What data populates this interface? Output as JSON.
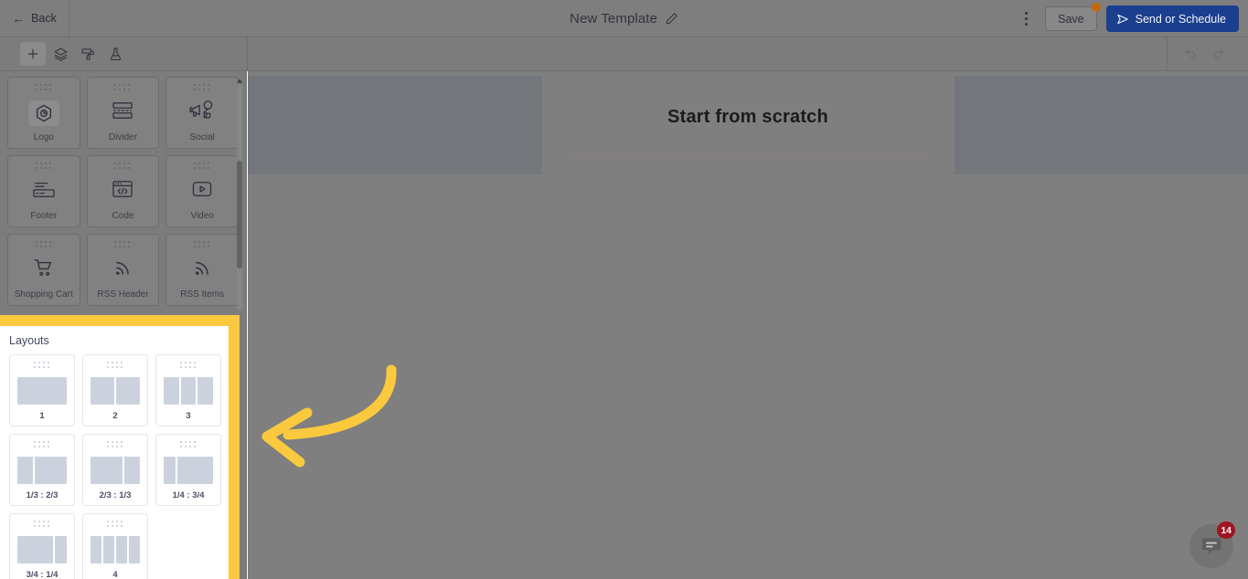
{
  "header": {
    "back_label": "Back",
    "back_icon": "arrow-left-icon",
    "title": "New Template",
    "edit_icon": "pencil-icon",
    "more_icon": "kebab-menu-icon",
    "save_label": "Save",
    "save_badge_color": "#c2680a",
    "send_label": "Send or Schedule",
    "send_icon": "paper-plane-icon",
    "send_color": "#1b3f8f"
  },
  "toolbar": {
    "tools": [
      {
        "name": "add-block-icon",
        "label": "Add",
        "active": true
      },
      {
        "name": "layers-icon",
        "label": "Layers",
        "active": false
      },
      {
        "name": "paint-roller-icon",
        "label": "Styles",
        "active": false
      },
      {
        "name": "flask-icon",
        "label": "Test",
        "active": false
      }
    ],
    "undo_icon": "undo-icon",
    "redo_icon": "redo-icon"
  },
  "sidebar": {
    "blocks": [
      {
        "label": "Logo",
        "icon": "logo-hexagon-icon",
        "boxed": true
      },
      {
        "label": "Divider",
        "icon": "divider-icon",
        "boxed": false
      },
      {
        "label": "Social",
        "icon": "social-megaphone-icon",
        "boxed": false
      },
      {
        "label": "Footer",
        "icon": "footer-icon",
        "boxed": false
      },
      {
        "label": "Code",
        "icon": "code-window-icon",
        "boxed": false
      },
      {
        "label": "Video",
        "icon": "video-play-icon",
        "boxed": false
      },
      {
        "label": "Shopping Cart",
        "icon": "shopping-cart-icon",
        "boxed": false
      },
      {
        "label": "RSS Header",
        "icon": "rss-icon",
        "boxed": false
      },
      {
        "label": "RSS Items",
        "icon": "rss-icon",
        "boxed": false
      }
    ]
  },
  "layouts": {
    "title": "Layouts",
    "highlight_color": "#fbc93d",
    "items": [
      {
        "label": "1",
        "columns": [
          1
        ]
      },
      {
        "label": "2",
        "columns": [
          1,
          1
        ]
      },
      {
        "label": "3",
        "columns": [
          1,
          1,
          1
        ]
      },
      {
        "label": "1/3 : 2/3",
        "columns": [
          1,
          2
        ]
      },
      {
        "label": "2/3 : 1/3",
        "columns": [
          2,
          1
        ]
      },
      {
        "label": "1/4 : 3/4",
        "columns": [
          1,
          3
        ]
      },
      {
        "label": "3/4 : 1/4",
        "columns": [
          3,
          1
        ]
      },
      {
        "label": "4",
        "columns": [
          1,
          1,
          1,
          1
        ]
      }
    ]
  },
  "canvas": {
    "heading": "Start from scratch"
  },
  "annotation": {
    "arrow_color": "#fbc93d",
    "arrow_direction": "left"
  },
  "chat": {
    "icon": "chat-bubble-icon",
    "badge_count": "14",
    "badge_color": "#a01523"
  }
}
